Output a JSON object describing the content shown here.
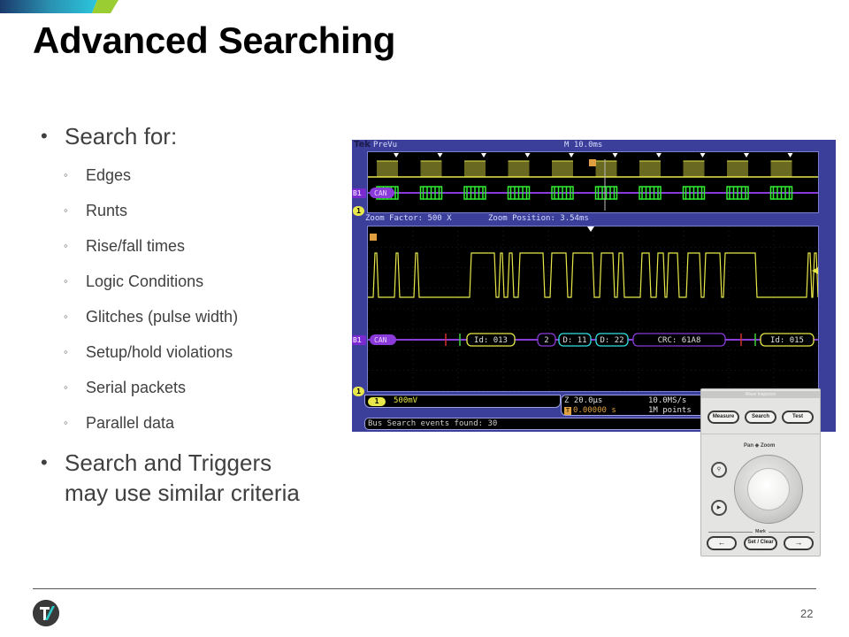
{
  "slide": {
    "title": "Advanced Searching",
    "page_number": "22",
    "accent_colors": {
      "dark_blue": "#1b3a6b",
      "teal": "#2bb8d6",
      "green": "#9acd32"
    }
  },
  "bullets": {
    "heading": "Search for:",
    "items": [
      "Edges",
      "Runts",
      "Rise/fall times",
      "Logic Conditions",
      "Glitches (pulse width)",
      "Setup/hold  violations",
      "Serial packets",
      "Parallel data"
    ],
    "closing_line1": "Search  and Triggers",
    "closing_line2": "may use similar criteria"
  },
  "scope": {
    "brand": "Tek",
    "mode": "PreVu",
    "timebase": "M 10.0ms",
    "zoom_factor": "Zoom Factor: 500 X",
    "zoom_position": "Zoom Position: 3.54ms",
    "bus_label": "B1",
    "bus_protocol": "CAN",
    "channel_label": "1",
    "channel_scale": "500mV",
    "zoom_scale": "Z 20.0µs",
    "trigger_position": "0.00000 s",
    "sample_rate": "10.0MS/s",
    "record_length": "1M points",
    "search_status": "Bus Search events found: 30",
    "packets": [
      {
        "label": "Id: 013",
        "kind": "id"
      },
      {
        "label": "2",
        "kind": "dlc"
      },
      {
        "label": "D: 11",
        "kind": "data"
      },
      {
        "label": "D: 22",
        "kind": "data"
      },
      {
        "label": "CRC: 61A8",
        "kind": "crc"
      },
      {
        "label": "Id: 015",
        "kind": "id"
      }
    ],
    "colors": {
      "channel1": "#e8e84a",
      "bus": "#8a3ad8",
      "bus_active": "#33ee33",
      "data": "#33e0e0",
      "id": "#e8e84a",
      "frame": "#3b3f9a"
    }
  },
  "front_panel": {
    "title": "Wave Inspector",
    "buttons": [
      "Measure",
      "Search",
      "Test"
    ],
    "knob_label": "Pan ◈ Zoom",
    "side_buttons": [
      "zoom",
      "play/pause"
    ],
    "mark_label": "Mark",
    "mark_buttons": [
      "←",
      "Set / Clear",
      "→"
    ]
  }
}
